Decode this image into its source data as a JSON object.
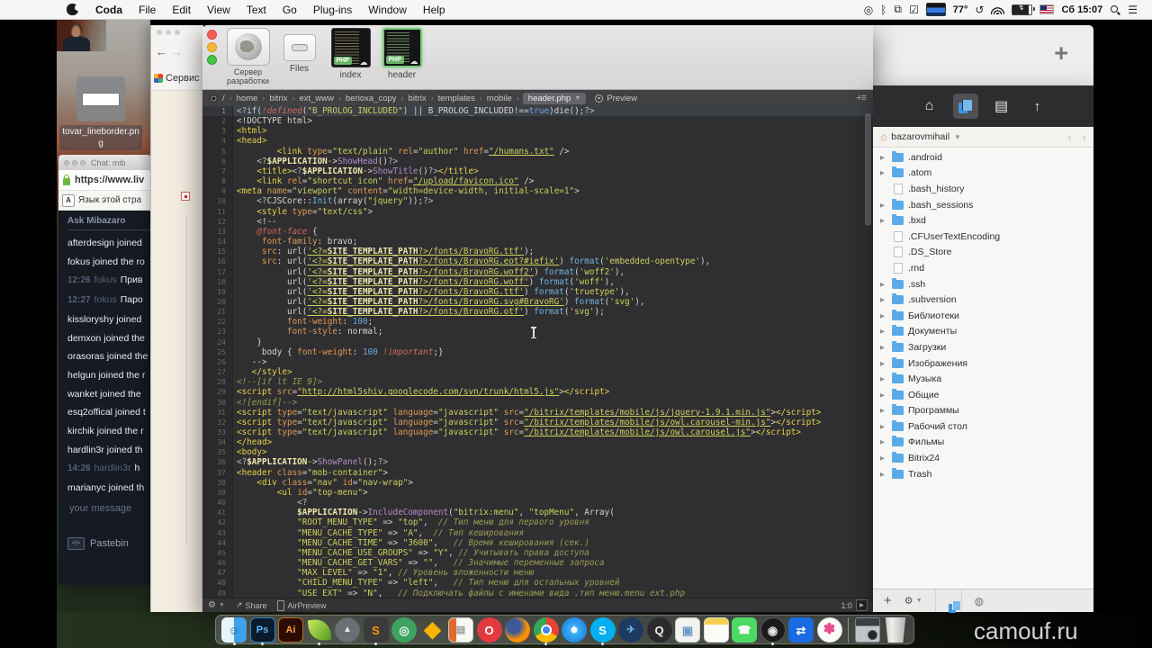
{
  "menu_bar": {
    "app_menus": [
      "Coda",
      "File",
      "Edit",
      "View",
      "Text",
      "Go",
      "Plug-ins",
      "Window",
      "Help"
    ],
    "status_items": [
      {
        "name": "app-menu-icon",
        "glyph": "◎"
      },
      {
        "name": "bluetooth-icon",
        "glyph": "ᛒ"
      },
      {
        "name": "display-mirroring-icon",
        "glyph": "⧉"
      },
      {
        "name": "reminder-check-icon",
        "glyph": "☑"
      },
      {
        "name": "weather-widget",
        "css": "widget"
      },
      {
        "name": "temperature",
        "text": "77°"
      },
      {
        "name": "time-machine-icon",
        "glyph": "↺"
      },
      {
        "name": "wifi-icon",
        "css": "wifi"
      },
      {
        "name": "battery-icon",
        "css": "battery"
      },
      {
        "name": "input-language-flag",
        "css": "usflag"
      },
      {
        "name": "menubar-clock",
        "text": "Сб 15:07"
      },
      {
        "name": "spotlight-icon",
        "css": "spot"
      },
      {
        "name": "notification-center-icon",
        "glyph": "☰"
      }
    ]
  },
  "desktop": {
    "file_label": "tovar_lineborder.png"
  },
  "watermark": "camouf.ru",
  "chat_window": {
    "title": "Chat: mib",
    "url": "https://www.liv",
    "translate_bar": "Язык этой стра",
    "header": "Ask Mibazaro",
    "messages": [
      {
        "text": "afterdesign joined"
      },
      {
        "text": "fokus joined the ro"
      },
      {
        "time": "12:26",
        "user": "fokus",
        "text": "Прив"
      },
      {
        "time": "12:27",
        "user": "fokus",
        "text": "Паро"
      },
      {
        "text": "kissloryshy joined"
      },
      {
        "text": "demxon joined the"
      },
      {
        "text": "orasoras joined the"
      },
      {
        "text": "helgun joined the r"
      },
      {
        "text": "wanket joined the"
      },
      {
        "text": "esq2offical joined t"
      },
      {
        "text": "kirchik joined the r"
      },
      {
        "text": "hardlin3r joined th"
      },
      {
        "time": "14:26",
        "user": "hardlin3r",
        "text": "h"
      },
      {
        "text": "marianyc joined th"
      }
    ],
    "input_placeholder": "your message",
    "pastebin_label": "Pastebin"
  },
  "servis_window": {
    "menu_label": "Сервис"
  },
  "background_window": {
    "new_tab": "+"
  },
  "coda": {
    "toolbar": {
      "server": "Сервер разработки",
      "files": "Files",
      "index": "index",
      "header": "header",
      "php_badge": "PHP"
    },
    "breadcrumb": {
      "path": [
        "/",
        "home",
        "bitrix",
        "ext_www",
        "berioxa_copy",
        "bitrix",
        "templates",
        "mobile"
      ],
      "active": "header.php",
      "preview": "Preview"
    },
    "statusbar": {
      "share": "Share",
      "airpreview": "AirPreview",
      "ratio": "1:0"
    },
    "editor": {
      "lines": [
        "<?if(!defined(\"B_PROLOG_INCLUDED\") || B_PROLOG_INCLUDED!==true)die();?>",
        "<!DOCTYPE html>",
        "<html>",
        "<head>",
        "        <link type=\"text/plain\" rel=\"author\" href=\"/humans.txt\" />",
        "    <?$APPLICATION->ShowHead()?>",
        "    <title><?$APPLICATION->ShowTitle()?></title>",
        "    <link rel=\"shortcut icon\" href=\"/upload/favicon.ico\" />",
        "<meta name=\"viewport\" content=\"width=device-width, initial-scale=1\">",
        "    <?CJSCore::Init(array(\"jquery\"));?>",
        "    <style type=\"text/css\">",
        "    <!--",
        "    @font-face {",
        "     font-family: bravo;",
        "     src: url('<?=SITE_TEMPLATE_PATH?>/fonts/BravoRG.ttf');",
        "     src: url('<?=SITE_TEMPLATE_PATH?>/fonts/BravoRG.eot?#iefix') format('embedded-opentype'),",
        "          url('<?=SITE_TEMPLATE_PATH?>/fonts/BravoRG.woff2') format('woff2'),",
        "          url('<?=SITE_TEMPLATE_PATH?>/fonts/BravoRG.woff') format('woff'),",
        "          url('<?=SITE_TEMPLATE_PATH?>/fonts/BravoRG.ttf') format('truetype'),",
        "          url('<?=SITE_TEMPLATE_PATH?>/fonts/BravoRG.svg#BravoRG') format('svg'),",
        "          url('<?=SITE_TEMPLATE_PATH?>/fonts/BravoRG.otf') format('svg');",
        "          font-weight: 100;",
        "          font-style: normal;",
        "    }",
        "     body { font-weight: 100 !important;}",
        "   -->",
        "   </style>",
        "<!--[if lt IE 9]>",
        "<script src=\"http://html5shiv.googlecode.com/svn/trunk/html5.js\"></script>",
        "<![endif]-->",
        "<script type=\"text/javascript\" language=\"javascript\" src=\"/bitrix/templates/mobile/js/jquery-1.9.1.min.js\"></script>",
        "<script type=\"text/javascript\" language=\"javascript\" src=\"/bitrix/templates/mobile/js/owl.carousel-min.js\"></script>",
        "<script type=\"text/javascript\" language=\"javascript\" src=\"/bitrix/templates/mobile/js/owl.carousel.js\"></script>",
        "</head>",
        "<body>",
        "<?$APPLICATION->ShowPanel();?>",
        "<header class=\"mob-container\">",
        "    <div class=\"nav\" id=\"nav-wrap\">",
        "        <ul id=\"top-menu\">",
        "            <?",
        "            $APPLICATION->IncludeComponent(\"bitrix:menu\", \"topMenu\", Array(",
        "            \"ROOT_MENU_TYPE\" => \"top\",  // Тип меню для первого уровня",
        "            \"MENU_CACHE_TYPE\" => \"A\",  // Тип кеширования",
        "            \"MENU_CACHE_TIME\" => \"3600\",   // Время кеширования (сек.)",
        "            \"MENU_CACHE_USE_GROUPS\" => \"Y\", // Учитывать права доступа",
        "            \"MENU_CACHE_GET_VARS\" => \"\",   // Значимые переменные запроса",
        "            \"MAX_LEVEL\" => \"1\", // Уровень вложенности меню",
        "            \"CHILD_MENU_TYPE\" => \"left\",   // Тип меню для остальных уровней",
        "            \"USE_EXT\" => \"N\",   // Подключать файлы с именами вида .тип меню.menu_ext.php"
      ]
    }
  },
  "sidebar": {
    "root": "bazarovmihail",
    "items": [
      {
        "name": ".android",
        "type": "folder"
      },
      {
        "name": ".atom",
        "type": "folder"
      },
      {
        "name": ".bash_history",
        "type": "file"
      },
      {
        "name": ".bash_sessions",
        "type": "folder"
      },
      {
        "name": ".bxd",
        "type": "folder"
      },
      {
        "name": ".CFUserTextEncoding",
        "type": "file"
      },
      {
        "name": ".DS_Store",
        "type": "file"
      },
      {
        "name": ".rnd",
        "type": "file"
      },
      {
        "name": ".ssh",
        "type": "folder"
      },
      {
        "name": ".subversion",
        "type": "folder"
      },
      {
        "name": "Библиотеки",
        "type": "folder"
      },
      {
        "name": "Документы",
        "type": "folder"
      },
      {
        "name": "Загрузки",
        "type": "folder"
      },
      {
        "name": "Изображения",
        "type": "folder"
      },
      {
        "name": "Музыка",
        "type": "folder"
      },
      {
        "name": "Общие",
        "type": "folder"
      },
      {
        "name": "Программы",
        "type": "folder"
      },
      {
        "name": "Рабочий стол",
        "type": "folder"
      },
      {
        "name": "Фильмы",
        "type": "folder"
      },
      {
        "name": "Bitrix24",
        "type": "folder"
      },
      {
        "name": "Trash",
        "type": "folder"
      }
    ]
  },
  "dock": {
    "icons": [
      {
        "name": "finder",
        "shape": "rect",
        "bg": "linear-gradient(90deg,#e8f4fd 0 50%,#3fa2e9 50%)",
        "glyph": "☺",
        "fg": "#1565a8",
        "running": true
      },
      {
        "name": "photoshop",
        "shape": "rect",
        "bg": "#0a1b2c",
        "border": "#2f7fc0",
        "glyph": "Ps",
        "fg": "#5cb8ff",
        "size": 11,
        "running": true
      },
      {
        "name": "illustrator",
        "shape": "rect",
        "bg": "#2b0d00",
        "border": "#c06a1f",
        "glyph": "Ai",
        "fg": "#ff9a3d",
        "size": 11
      },
      {
        "name": "coda",
        "shape": "leaf",
        "running": true
      },
      {
        "name": "launchpad",
        "shape": "circle",
        "bg": "radial-gradient(circle,#6a6f75 0 60%,#4a4e53)",
        "glyph": "▲",
        "fg": "#e8e8e8",
        "size": 10
      },
      {
        "name": "sublime-text",
        "shape": "rect",
        "bg": "#3b3b3b",
        "glyph": "S",
        "fg": "#ff9800",
        "running": true
      },
      {
        "name": "atom",
        "shape": "circle",
        "bg": "#3da35f",
        "glyph": "◎",
        "fg": "#eaf7ee"
      },
      {
        "name": "sketch",
        "shape": "plain",
        "glyph": "◆",
        "fg": "#fdb300",
        "size": 24
      },
      {
        "name": "notebook",
        "shape": "rect",
        "bg": "linear-gradient(90deg,#e06a2b 0 30%,#f8f8f4 30%)",
        "border": "#c8c8c0",
        "glyph": "▤",
        "fg": "#999",
        "size": 11
      },
      {
        "name": "opera",
        "shape": "circle",
        "bg": "#e23a3f",
        "glyph": "O",
        "fg": "#fff"
      },
      {
        "name": "firefox",
        "shape": "circle",
        "bg": "radial-gradient(circle at 35% 35%,#3b5998 0 28%,#ff9500 60%,#e66000)"
      },
      {
        "name": "chrome",
        "shape": "chrome",
        "running": true
      },
      {
        "name": "safari",
        "shape": "circle",
        "bg": "radial-gradient(circle,#e8f8ff 0 16%,#3bb2f4 20%,#1470d8)",
        "glyph": "✦",
        "fg": "#fff",
        "size": 10
      },
      {
        "name": "skype",
        "shape": "circle",
        "bg": "#00aff0",
        "glyph": "S",
        "fg": "#fff",
        "running": true
      },
      {
        "name": "telegram",
        "shape": "circle",
        "bg": "#1e3a5f",
        "glyph": "✈",
        "fg": "#6cb8e8",
        "size": 11
      },
      {
        "name": "quicktime",
        "shape": "circle",
        "bg": "#2b2b2d",
        "glyph": "Q",
        "fg": "#eee"
      },
      {
        "name": "preview",
        "shape": "rect",
        "bg": "#f2f2ee",
        "border": "#ccc",
        "glyph": "▣",
        "fg": "#6a9ac8"
      },
      {
        "name": "notes",
        "shape": "rect",
        "bg": "linear-gradient(#f5d04e 0 26%,#fbfbf6 26%)",
        "border": "#d8d8d0"
      },
      {
        "name": "facetime",
        "shape": "rect",
        "bg": "#4cd964",
        "glyph": "☎",
        "fg": "#fff",
        "size": 12
      },
      {
        "name": "obs",
        "shape": "circle",
        "bg": "#1b1b1b",
        "border": "#555",
        "glyph": "◉",
        "fg": "#e8e8e8",
        "running": true
      },
      {
        "name": "teamviewer",
        "shape": "rect",
        "bg": "#1a6ae0",
        "glyph": "⇄",
        "fg": "#fff"
      },
      {
        "name": "photos",
        "shape": "circle",
        "bg": "#fbfbf8",
        "border": "#ddd",
        "glyph": "✽",
        "fg": "#e84a8a",
        "size": 16
      },
      {
        "name": "separator"
      },
      {
        "name": "screenshot-thumb",
        "shape": "thumb"
      },
      {
        "name": "trash",
        "shape": "trash"
      }
    ]
  },
  "colors": {
    "accent_blue": "#3f94e0",
    "php_badge_green": "#6ebe6e",
    "selection_green": "#7dc87d",
    "editor_bg": "#2f2f31",
    "chat_bg": "#161a22"
  }
}
